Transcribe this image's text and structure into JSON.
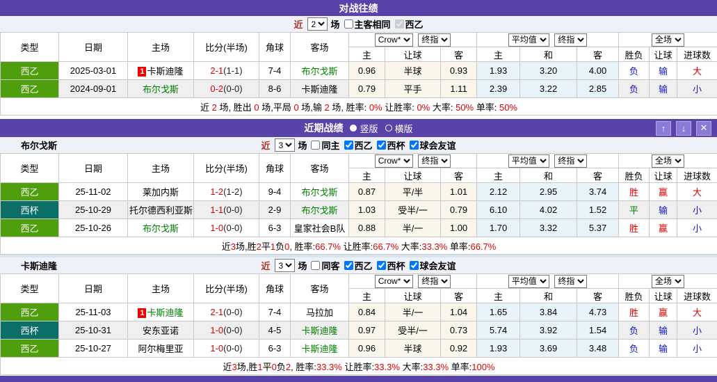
{
  "colors": {
    "titlebar_purple": "#5a43a8",
    "league_green": "#4e9e0d",
    "league_teal": "#0b6f68",
    "focus_team_green": "#008000",
    "win_red": "#e00000",
    "loss_blue": "#1414cc",
    "odds_cream_bg": "#fbf6ec",
    "avg_blue_bg": "#e8f3f9"
  },
  "headers": {
    "type": "类型",
    "date": "日期",
    "home": "主场",
    "score": "比分(半场)",
    "corner": "角球",
    "away": "客场",
    "odds_source": "Crow*",
    "odds_kind": "终指",
    "avg_source": "平均值",
    "avg_kind": "终指",
    "scope": "全场",
    "sub": [
      "主",
      "让球",
      "客",
      "主",
      "和",
      "客",
      "胜负",
      "让球",
      "进球数"
    ]
  },
  "h2h": {
    "title": "对战往绩",
    "controls": {
      "near_label": "近",
      "count": "2",
      "games_label": "场",
      "filters": [
        {
          "label": "主客相同",
          "checked": false,
          "disabled": false
        },
        {
          "label": "西乙",
          "checked": true,
          "disabled": true
        }
      ]
    },
    "rows": [
      {
        "type": "西乙",
        "type_cls": "lg-green",
        "date": "2025-03-01",
        "home_badge": "1",
        "home": "卡斯迪隆",
        "home_cls": "",
        "score": "2-1",
        "half": "(1-1)",
        "corner": "7-4",
        "away": "布尔戈斯",
        "away_cls": "t-focus",
        "o1": "0.96",
        "o2": "半球",
        "o3": "0.93",
        "a1": "1.93",
        "a2": "3.20",
        "a3": "4.00",
        "r1": "负",
        "r1c": "c-blue",
        "r2": "输",
        "r2c": "c-blue",
        "r3": "大",
        "r3c": "c-red"
      },
      {
        "type": "西乙",
        "type_cls": "lg-green",
        "date": "2024-09-01",
        "home_badge": "",
        "home": "布尔戈斯",
        "home_cls": "t-focus",
        "score": "0-2",
        "half": "(0-0)",
        "corner": "8-6",
        "away": "卡斯迪隆",
        "away_cls": "",
        "o1": "0.79",
        "o2": "平手",
        "o3": "1.11",
        "a1": "2.39",
        "a2": "3.22",
        "a3": "2.85",
        "r1": "负",
        "r1c": "c-blue",
        "r2": "输",
        "r2c": "c-blue",
        "r3": "小",
        "r3c": "c-blue"
      }
    ],
    "summary": [
      {
        "t": "近 "
      },
      {
        "t": "2",
        "c": "c-red"
      },
      {
        "t": " 场, 胜出 "
      },
      {
        "t": "0",
        "c": "c-red"
      },
      {
        "t": " 场,平局 "
      },
      {
        "t": "0",
        "c": "c-red"
      },
      {
        "t": " 场,输 "
      },
      {
        "t": "2",
        "c": "c-red"
      },
      {
        "t": " 场, 胜率: "
      },
      {
        "t": "0%",
        "c": "c-red"
      },
      {
        "t": " 让胜率: "
      },
      {
        "t": "0%",
        "c": "c-red"
      },
      {
        "t": " 大率: "
      },
      {
        "t": "50%",
        "c": "c-red"
      },
      {
        "t": " 单率: "
      },
      {
        "t": "50%",
        "c": "c-red"
      }
    ]
  },
  "recent": {
    "title": "近期战绩",
    "view_options": [
      {
        "label": "竖版",
        "selected": true
      },
      {
        "label": "横版",
        "selected": false
      }
    ],
    "buttons": [
      {
        "name": "move-up",
        "glyph": "↑"
      },
      {
        "name": "move-down",
        "glyph": "↓"
      },
      {
        "name": "close",
        "glyph": "✕"
      }
    ],
    "teams": [
      {
        "name": "布尔戈斯",
        "controls": {
          "near_label": "近",
          "count": "3",
          "games_label": "场",
          "filters": [
            {
              "label": "同主",
              "checked": false,
              "disabled": false
            },
            {
              "label": "西乙",
              "checked": true,
              "disabled": false
            },
            {
              "label": "西杯",
              "checked": true,
              "disabled": false
            },
            {
              "label": "球会友谊",
              "checked": true,
              "disabled": false
            }
          ]
        },
        "rows": [
          {
            "type": "西乙",
            "type_cls": "lg-green",
            "date": "25-11-02",
            "home_badge": "",
            "home": "莱加内斯",
            "home_cls": "",
            "score": "1-2",
            "half": "(1-2)",
            "corner": "9-4",
            "away": "布尔戈斯",
            "away_cls": "t-focus",
            "o1": "0.87",
            "o2": "平/半",
            "o3": "1.01",
            "a1": "2.12",
            "a2": "2.95",
            "a3": "3.74",
            "r1": "胜",
            "r1c": "c-red",
            "r2": "赢",
            "r2c": "c-red",
            "r3": "大",
            "r3c": "c-red"
          },
          {
            "type": "西杯",
            "type_cls": "lg-teal",
            "date": "25-10-29",
            "home_badge": "",
            "home": "托尔德西利亚斯",
            "home_cls": "",
            "score": "1-1",
            "half": "(0-0)",
            "corner": "2-9",
            "away": "布尔戈斯",
            "away_cls": "t-focus",
            "o1": "1.03",
            "o2": "受半/一",
            "o3": "0.79",
            "a1": "6.10",
            "a2": "4.02",
            "a3": "1.52",
            "r1": "平",
            "r1c": "c-green",
            "r2": "输",
            "r2c": "c-blue",
            "r3": "小",
            "r3c": "c-blue"
          },
          {
            "type": "西乙",
            "type_cls": "lg-green",
            "date": "25-10-26",
            "home_badge": "",
            "home": "布尔戈斯",
            "home_cls": "t-focus",
            "score": "1-0",
            "half": "(0-0)",
            "corner": "6-3",
            "away": "皇家社会B队",
            "away_cls": "",
            "o1": "0.88",
            "o2": "半/一",
            "o3": "1.00",
            "a1": "1.70",
            "a2": "3.32",
            "a3": "5.37",
            "r1": "胜",
            "r1c": "c-red",
            "r2": "赢",
            "r2c": "c-red",
            "r3": "小",
            "r3c": "c-blue"
          }
        ],
        "summary": [
          {
            "t": "近"
          },
          {
            "t": "3",
            "c": "c-red"
          },
          {
            "t": "场,胜"
          },
          {
            "t": "2",
            "c": "c-red"
          },
          {
            "t": "平"
          },
          {
            "t": "1",
            "c": "c-red"
          },
          {
            "t": "负"
          },
          {
            "t": "0",
            "c": "c-red"
          },
          {
            "t": ", 胜率:"
          },
          {
            "t": "66.7%",
            "c": "c-red"
          },
          {
            "t": " 让胜率:"
          },
          {
            "t": "66.7%",
            "c": "c-red"
          },
          {
            "t": " 大率:"
          },
          {
            "t": "33.3%",
            "c": "c-red"
          },
          {
            "t": " 单率:"
          },
          {
            "t": "66.7%",
            "c": "c-red"
          }
        ]
      },
      {
        "name": "卡斯迪隆",
        "controls": {
          "near_label": "近",
          "count": "3",
          "games_label": "场",
          "filters": [
            {
              "label": "同客",
              "checked": false,
              "disabled": false
            },
            {
              "label": "西乙",
              "checked": true,
              "disabled": false
            },
            {
              "label": "西杯",
              "checked": true,
              "disabled": false
            },
            {
              "label": "球会友谊",
              "checked": true,
              "disabled": false
            }
          ]
        },
        "rows": [
          {
            "type": "西乙",
            "type_cls": "lg-green",
            "date": "25-11-03",
            "home_badge": "1",
            "home": "卡斯迪隆",
            "home_cls": "t-focus",
            "score": "2-1",
            "half": "(0-0)",
            "corner": "7-4",
            "away": "马拉加",
            "away_cls": "",
            "o1": "0.84",
            "o2": "半/一",
            "o3": "1.04",
            "a1": "1.65",
            "a2": "3.84",
            "a3": "4.73",
            "r1": "胜",
            "r1c": "c-red",
            "r2": "赢",
            "r2c": "c-red",
            "r3": "大",
            "r3c": "c-red"
          },
          {
            "type": "西杯",
            "type_cls": "lg-teal",
            "date": "25-10-31",
            "home_badge": "",
            "home": "安东亚诺",
            "home_cls": "",
            "score": "1-0",
            "half": "(0-0)",
            "corner": "4-5",
            "away": "卡斯迪隆",
            "away_cls": "t-focus",
            "o1": "0.97",
            "o2": "受半/一",
            "o3": "0.73",
            "a1": "5.74",
            "a2": "3.92",
            "a3": "1.54",
            "r1": "负",
            "r1c": "c-blue",
            "r2": "输",
            "r2c": "c-blue",
            "r3": "小",
            "r3c": "c-blue"
          },
          {
            "type": "西乙",
            "type_cls": "lg-green",
            "date": "25-10-27",
            "home_badge": "",
            "home": "阿尔梅里亚",
            "home_cls": "",
            "score": "1-0",
            "half": "(0-0)",
            "corner": "6-3",
            "away": "卡斯迪隆",
            "away_cls": "t-focus",
            "o1": "0.96",
            "o2": "半球",
            "o3": "0.92",
            "a1": "1.93",
            "a2": "3.69",
            "a3": "3.48",
            "r1": "负",
            "r1c": "c-blue",
            "r2": "输",
            "r2c": "c-blue",
            "r3": "小",
            "r3c": "c-blue"
          }
        ],
        "summary": [
          {
            "t": "近"
          },
          {
            "t": "3",
            "c": "c-red"
          },
          {
            "t": "场,胜"
          },
          {
            "t": "1",
            "c": "c-red"
          },
          {
            "t": "平"
          },
          {
            "t": "0",
            "c": "c-red"
          },
          {
            "t": "负"
          },
          {
            "t": "2",
            "c": "c-red"
          },
          {
            "t": ", 胜率:"
          },
          {
            "t": "33.3%",
            "c": "c-red"
          },
          {
            "t": " 让胜率:"
          },
          {
            "t": "33.3%",
            "c": "c-red"
          },
          {
            "t": " 大率:"
          },
          {
            "t": "33.3%",
            "c": "c-red"
          },
          {
            "t": " 单率:"
          },
          {
            "t": "100%",
            "c": "c-red"
          }
        ]
      }
    ]
  }
}
